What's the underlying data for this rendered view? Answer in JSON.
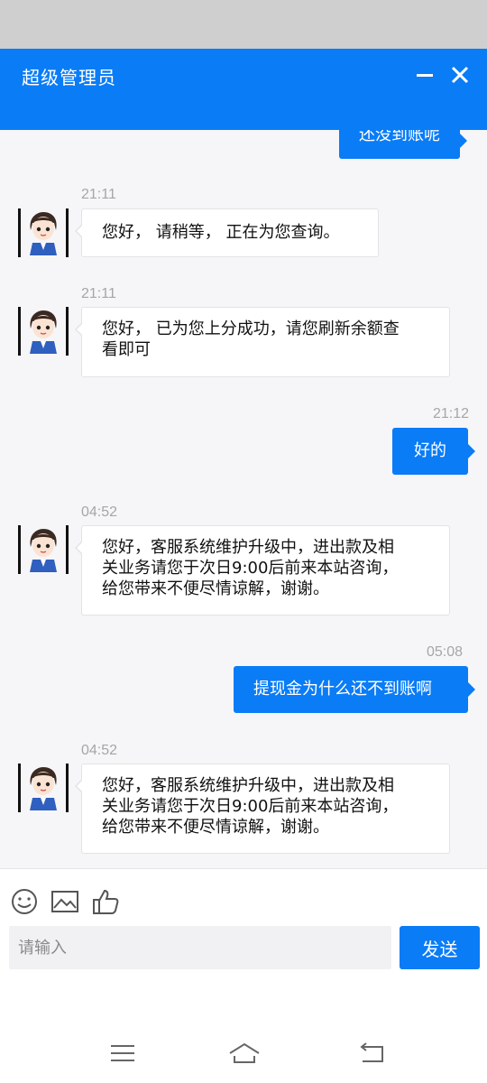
{
  "header": {
    "title": "超级管理员",
    "minimize_icon": "minimize-icon",
    "close_icon": "close-icon"
  },
  "messages": [
    {
      "direction": "out",
      "text": "还没到账呢"
    },
    {
      "direction": "in",
      "time": "21:11",
      "text": "您好， 请稍等， 正在为您查询。"
    },
    {
      "direction": "in",
      "time": "21:11",
      "lines": [
        "您好， 已为您上分成功，请您刷新余额查",
        "看即可"
      ]
    },
    {
      "direction": "out",
      "time": "21:12",
      "text": "好的"
    },
    {
      "direction": "in",
      "time": "04:52",
      "lines": [
        "您好，客服系统维护升级中，进出款及相",
        "关业务请您于次日9:00后前来本站咨询，",
        "给您带来不便尽情谅解，谢谢。"
      ]
    },
    {
      "direction": "out",
      "time": "05:08",
      "text": "提现金为什么还不到账啊"
    },
    {
      "direction": "in",
      "time": "04:52",
      "lines": [
        "您好，客服系统维护升级中，进出款及相",
        "关业务请您于次日9:00后前来本站咨询，",
        "给您带来不便尽情谅解，谢谢。"
      ]
    }
  ],
  "toolbar": {
    "icons": [
      "emoji-icon",
      "image-icon",
      "thumbs-up-icon"
    ]
  },
  "composer": {
    "placeholder": "请输入",
    "send_label": "发送"
  },
  "navbar": {
    "icons": [
      "menu-icon",
      "home-icon",
      "back-icon"
    ]
  },
  "colors": {
    "accent": "#0a7cf6",
    "chat_bg": "#f6f6f8",
    "time_text": "#a6a6a6"
  }
}
